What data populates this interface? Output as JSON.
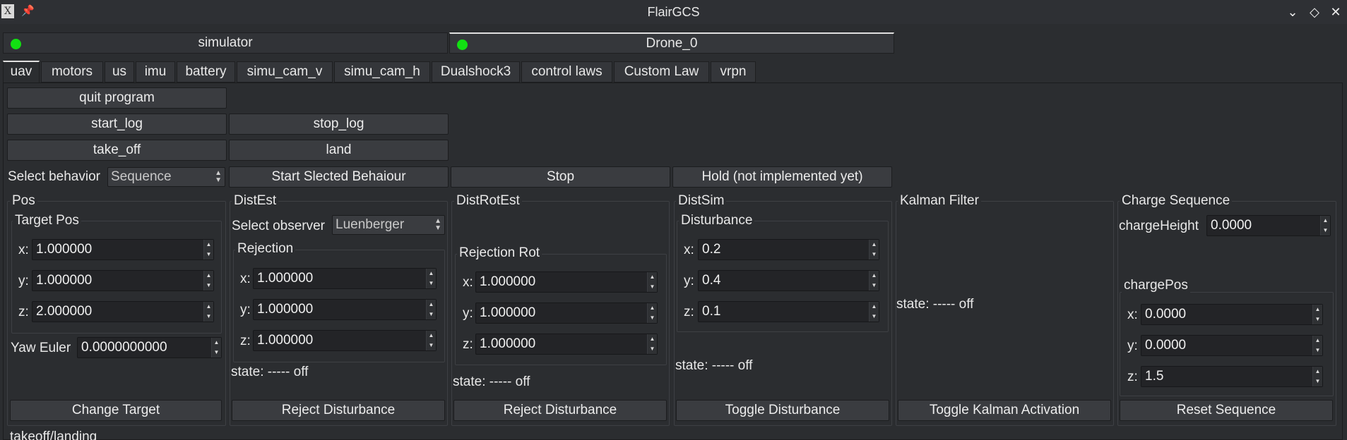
{
  "window": {
    "title": "FlairGCS"
  },
  "drone_tabs": [
    {
      "label": "simulator"
    },
    {
      "label": "Drone_0"
    }
  ],
  "uav_tabs": [
    "uav",
    "motors",
    "us",
    "imu",
    "battery",
    "simu_cam_v",
    "simu_cam_h",
    "Dualshock3",
    "control laws",
    "Custom Law",
    "vrpn"
  ],
  "buttons": {
    "quit": "quit program",
    "start_log": "start_log",
    "stop_log": "stop_log",
    "take_off": "take_off",
    "land": "land",
    "start_behaviour": "Start Slected Behaiour",
    "stop": "Stop",
    "hold": "Hold (not implemented yet)"
  },
  "behavior": {
    "label": "Select behavior",
    "value": "Sequence"
  },
  "pos": {
    "title": "Pos",
    "target_title": "Target Pos",
    "x_label": "x:",
    "x": "1.000000",
    "y_label": "y:",
    "y": "1.000000",
    "z_label": "z:",
    "z": "2.000000",
    "yaw_label": "Yaw Euler",
    "yaw": "0.0000000000",
    "button": "Change Target"
  },
  "distest": {
    "title": "DistEst",
    "observer_label": "Select observer",
    "observer_value": "Luenberger",
    "rejection_title": "Rejection",
    "x_label": "x:",
    "x": "1.000000",
    "y_label": "y:",
    "y": "1.000000",
    "z_label": "z:",
    "z": "1.000000",
    "state": "state: ----- off",
    "button": "Reject Disturbance"
  },
  "distrotest": {
    "title": "DistRotEst",
    "rejection_title": "Rejection Rot",
    "x_label": "x:",
    "x": "1.000000",
    "y_label": "y:",
    "y": "1.000000",
    "z_label": "z:",
    "z": "1.000000",
    "state": "state: ----- off",
    "button": "Reject Disturbance"
  },
  "distsim": {
    "title": "DistSim",
    "disturbance_title": "Disturbance",
    "x_label": "x:",
    "x": "0.2",
    "y_label": "y:",
    "y": "0.4",
    "z_label": "z:",
    "z": "0.1",
    "state": "state: ----- off",
    "button": "Toggle Disturbance"
  },
  "kalman": {
    "title": "Kalman Filter",
    "state": "state: ----- off",
    "button": "Toggle Kalman Activation"
  },
  "charge": {
    "title": "Charge Sequence",
    "height_label": "chargeHeight",
    "height": "0.0000",
    "pos_title": "chargePos",
    "x_label": "x:",
    "x": "0.0000",
    "y_label": "y:",
    "y": "0.0000",
    "z_label": "z:",
    "z": "1.5",
    "button": "Reset Sequence"
  },
  "footer": {
    "label": "takeoff/landing"
  }
}
